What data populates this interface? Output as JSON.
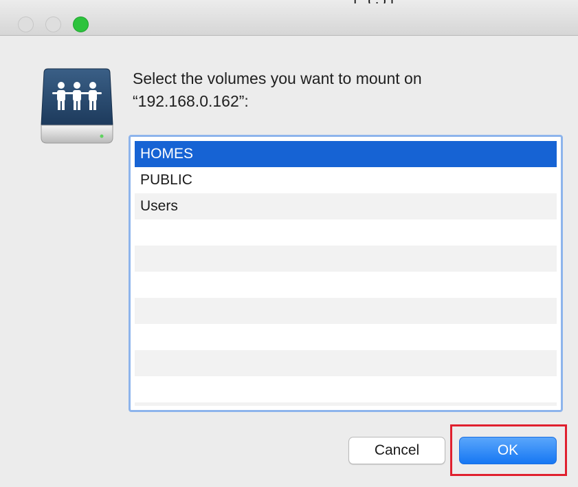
{
  "window": {
    "traffic_lights": [
      "close",
      "minimize",
      "zoom"
    ],
    "top_partial_text": "[ (:)]"
  },
  "dialog": {
    "icon": "shared-server-icon",
    "prompt_line1": "Select the volumes you want to mount on",
    "prompt_line2": "“192.168.0.162”:"
  },
  "volumes": {
    "items": [
      {
        "label": "HOMES",
        "selected": true
      },
      {
        "label": "PUBLIC",
        "selected": false
      },
      {
        "label": "Users",
        "selected": false
      }
    ]
  },
  "buttons": {
    "cancel_label": "Cancel",
    "ok_label": "OK"
  },
  "colors": {
    "selection": "#1663d4",
    "focus_ring": "#8db4ec",
    "default_button": "#1677f3",
    "annotation_box": "#e0202e",
    "zoom_button": "#2dc33d"
  }
}
